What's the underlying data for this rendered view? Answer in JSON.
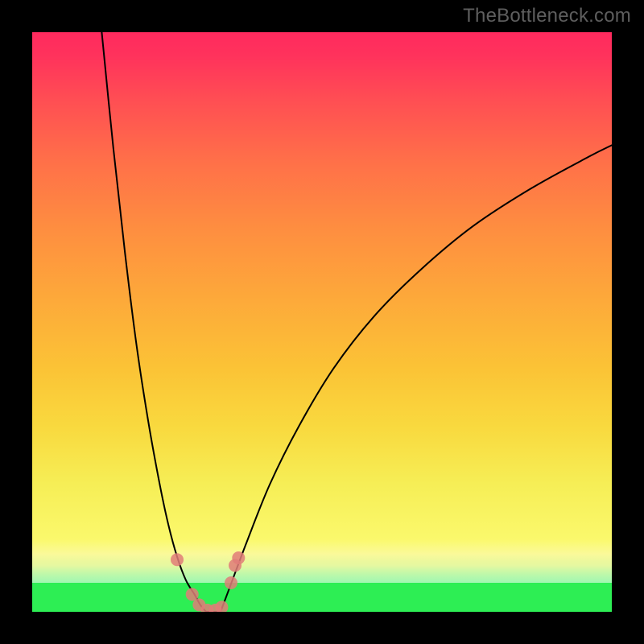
{
  "watermark": "TheBottleneck.com",
  "chart_data": {
    "type": "line",
    "title": "",
    "xlabel": "",
    "ylabel": "",
    "xlim": [
      0,
      100
    ],
    "ylim": [
      0,
      100
    ],
    "background_gradient_stops": [
      {
        "pos": 0.0,
        "color": "#2dee54"
      },
      {
        "pos": 0.05,
        "color": "#2dee54"
      },
      {
        "pos": 0.08,
        "color": "#d3f35a"
      },
      {
        "pos": 0.1,
        "color": "#f9f770"
      },
      {
        "pos": 0.12,
        "color": "#fbf96d"
      },
      {
        "pos": 0.22,
        "color": "#f6ee56"
      },
      {
        "pos": 0.32,
        "color": "#f9d93e"
      },
      {
        "pos": 0.42,
        "color": "#fbc336"
      },
      {
        "pos": 0.54,
        "color": "#fda93a"
      },
      {
        "pos": 0.66,
        "color": "#fe8e40"
      },
      {
        "pos": 0.78,
        "color": "#ff6f49"
      },
      {
        "pos": 0.88,
        "color": "#ff4f53"
      },
      {
        "pos": 0.96,
        "color": "#ff325c"
      },
      {
        "pos": 1.0,
        "color": "#ff2a5e"
      }
    ],
    "series": [
      {
        "name": "left-branch",
        "x": [
          12.0,
          14.0,
          16.0,
          18.0,
          20.0,
          22.0,
          23.5,
          25.0,
          26.5,
          28.0,
          29.0,
          30.0
        ],
        "y": [
          100.0,
          80.0,
          62.0,
          46.0,
          33.0,
          22.0,
          15.0,
          9.5,
          5.5,
          3.0,
          1.2,
          0.0
        ]
      },
      {
        "name": "right-branch",
        "x": [
          32.5,
          34.0,
          37.0,
          41.0,
          46.0,
          52.0,
          59.0,
          67.0,
          76.0,
          86.0,
          96.0,
          100.0
        ],
        "y": [
          0.0,
          4.0,
          12.0,
          22.0,
          32.0,
          42.0,
          51.0,
          59.0,
          66.5,
          73.0,
          78.5,
          80.5
        ]
      },
      {
        "name": "valley-floor",
        "x": [
          30.0,
          32.5
        ],
        "y": [
          0.0,
          0.0
        ]
      }
    ],
    "markers": [
      {
        "x": 25.0,
        "y": 9.0
      },
      {
        "x": 27.6,
        "y": 3.0
      },
      {
        "x": 28.8,
        "y": 1.2
      },
      {
        "x": 30.2,
        "y": 0.3
      },
      {
        "x": 31.6,
        "y": 0.3
      },
      {
        "x": 32.7,
        "y": 0.8
      },
      {
        "x": 34.3,
        "y": 5.0
      },
      {
        "x": 35.0,
        "y": 8.0
      },
      {
        "x": 35.6,
        "y": 9.3
      }
    ],
    "marker_color": "#e07c78",
    "curve_color": "#000000"
  }
}
